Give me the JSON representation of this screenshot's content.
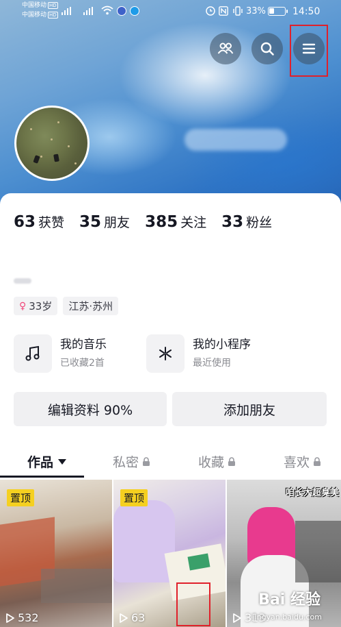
{
  "status_bar": {
    "carrier1": "中国移动",
    "carrier1_badge": "HD",
    "carrier2": "中国移动",
    "carrier2_badge": "HD",
    "battery_percent": "33%",
    "battery_level": 0.33,
    "time": "14:50"
  },
  "header": {
    "buttons": [
      {
        "icon": "friends-icon"
      },
      {
        "icon": "search-icon"
      },
      {
        "icon": "menu-icon"
      }
    ]
  },
  "stats": [
    {
      "value": "63",
      "label": "获赞"
    },
    {
      "value": "35",
      "label": "朋友"
    },
    {
      "value": "385",
      "label": "关注"
    },
    {
      "value": "33",
      "label": "粉丝"
    }
  ],
  "tags": {
    "gender_symbol": "♀",
    "age": "33岁",
    "location": "江苏·苏州"
  },
  "tiles": {
    "music": {
      "title": "我的音乐",
      "subtitle": "已收藏2首"
    },
    "miniprogram": {
      "title": "我的小程序",
      "subtitle": "最近使用"
    }
  },
  "actions": {
    "edit_profile": "编辑资料 90%",
    "add_friends": "添加朋友"
  },
  "tabs": [
    {
      "label": "作品"
    },
    {
      "label": "私密"
    },
    {
      "label": "收藏"
    },
    {
      "label": "喜欢"
    }
  ],
  "videos": [
    {
      "pin": "置顶",
      "plays": "532"
    },
    {
      "pin": "置顶",
      "plays": "63"
    },
    {
      "plays": "313",
      "overlay": "咱长大超臭美"
    }
  ],
  "watermark": {
    "main": "Bai 经验",
    "sub": "jingyan.baidu.com"
  },
  "colors": {
    "accent_highlight": "#e0202a",
    "pin_badge": "#f5d020",
    "hero_blue": "#4d8fd0"
  }
}
